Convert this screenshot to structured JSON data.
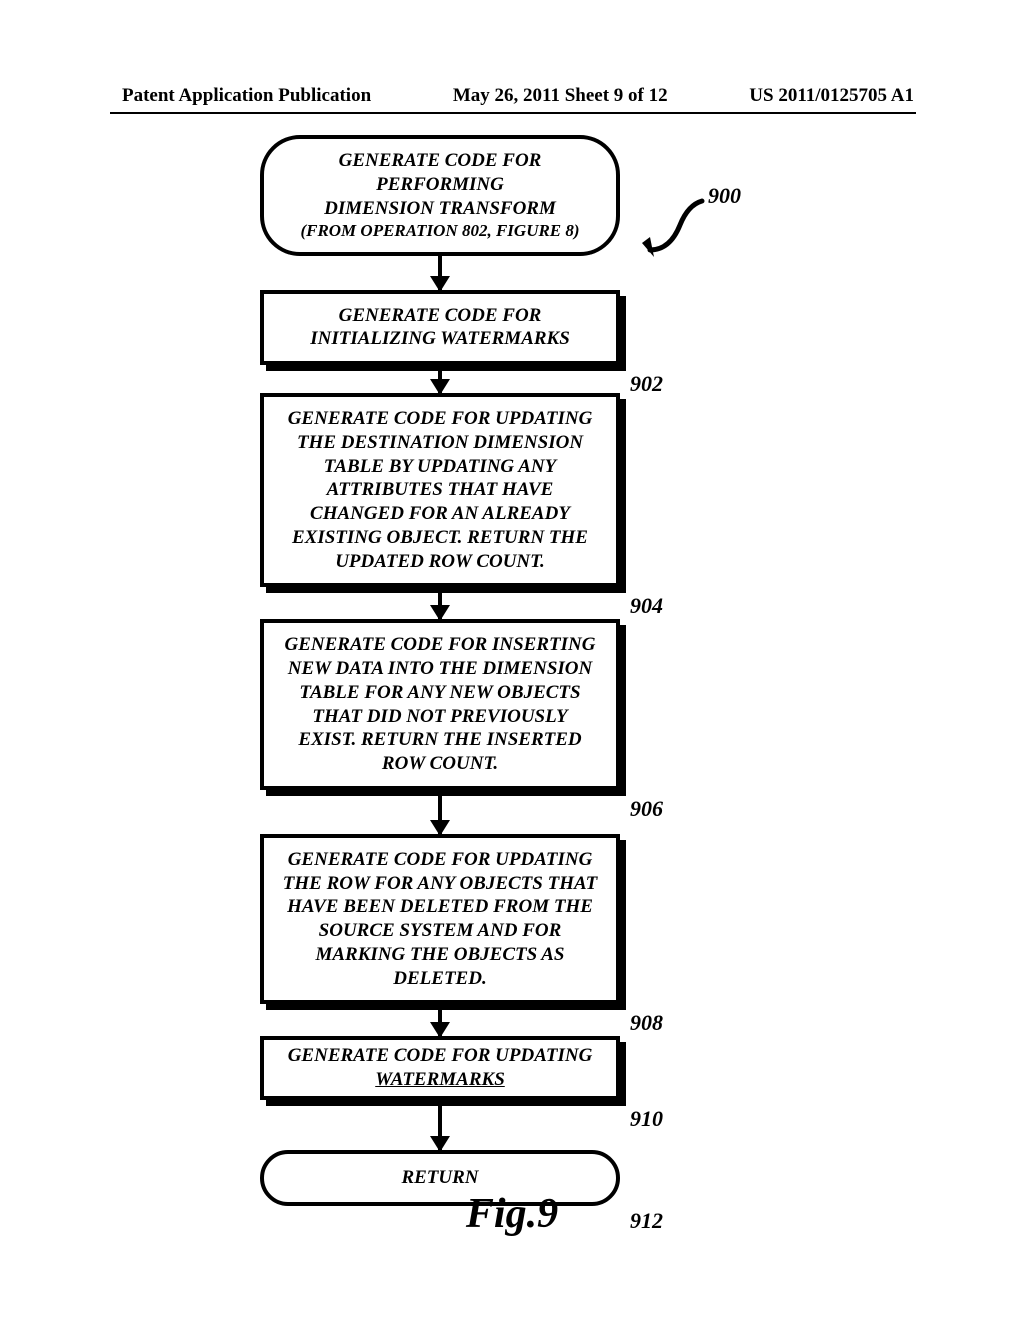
{
  "header": {
    "left": "Patent Application Publication",
    "center": "May 26, 2011  Sheet 9 of 12",
    "right": "US 2011/0125705 A1"
  },
  "ref": {
    "n900": "900",
    "n902": "902",
    "n904": "904",
    "n906": "906",
    "n908": "908",
    "n910": "910",
    "n912": "912"
  },
  "steps": {
    "start_l1": "GENERATE CODE FOR PERFORMING",
    "start_l2": "DIMENSION TRANSFORM",
    "start_l3": "(FROM OPERATION 802, FIGURE 8)",
    "s902_l1": "GENERATE CODE FOR",
    "s902_l2": "INITIALIZING WATERMARKS",
    "s904_l1": "GENERATE CODE FOR UPDATING",
    "s904_l2": "THE DESTINATION DIMENSION",
    "s904_l3": "TABLE BY UPDATING ANY",
    "s904_l4": "ATTRIBUTES THAT HAVE",
    "s904_l5": "CHANGED FOR AN ALREADY",
    "s904_l6": "EXISTING OBJECT.  RETURN THE",
    "s904_l7": "UPDATED ROW COUNT.",
    "s906_l1": "GENERATE CODE FOR INSERTING",
    "s906_l2": "NEW DATA INTO THE DIMENSION",
    "s906_l3": "TABLE FOR ANY NEW OBJECTS",
    "s906_l4": "THAT DID NOT PREVIOUSLY",
    "s906_l5": "EXIST.  RETURN THE INSERTED",
    "s906_l6": "ROW COUNT.",
    "s908_l1": "GENERATE CODE FOR UPDATING",
    "s908_l2": "THE ROW FOR ANY OBJECTS THAT",
    "s908_l3": "HAVE BEEN DELETED FROM THE",
    "s908_l4": "SOURCE SYSTEM AND FOR",
    "s908_l5": "MARKING THE OBJECTS AS",
    "s908_l6": "DELETED.",
    "s910_l1": "GENERATE CODE FOR UPDATING",
    "s910_l2": "WATERMARKS",
    "return": "RETURN"
  },
  "figure_label": "Fig.9"
}
